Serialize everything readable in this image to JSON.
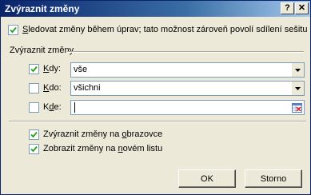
{
  "window": {
    "title": "Zvýraznit změny",
    "help_glyph": "?",
    "close_glyph": "✕"
  },
  "track_changes": {
    "label_prefix": "",
    "label_accel": "S",
    "label_rest": "ledovat změny během úprav; tato možnost zároveň povolí sdílení sešitu",
    "checked": true
  },
  "group": {
    "title": "Zvýraznit změny"
  },
  "when": {
    "label_accel": "K",
    "label_rest": "dy:",
    "checked": true,
    "value": "vše"
  },
  "who": {
    "label_accel": "K",
    "label_rest": "do:",
    "checked": false,
    "value": "všichni"
  },
  "where": {
    "label_prefix": "K",
    "label_accel": "d",
    "label_rest": "e:",
    "checked": false,
    "value": ""
  },
  "highlight_on_screen": {
    "label_prefix": "Zvýraznit změny na ",
    "label_accel": "o",
    "label_rest": "brazovce",
    "checked": true
  },
  "list_on_new_sheet": {
    "label_prefix": "Zobrazit změny na ",
    "label_accel": "n",
    "label_rest": "ovém listu",
    "checked": true
  },
  "buttons": {
    "ok": "OK",
    "cancel": "Storno"
  },
  "colors": {
    "titlebar_start": "#0a246a",
    "titlebar_end": "#a6caf0",
    "dialog_face": "#ece9d8"
  }
}
